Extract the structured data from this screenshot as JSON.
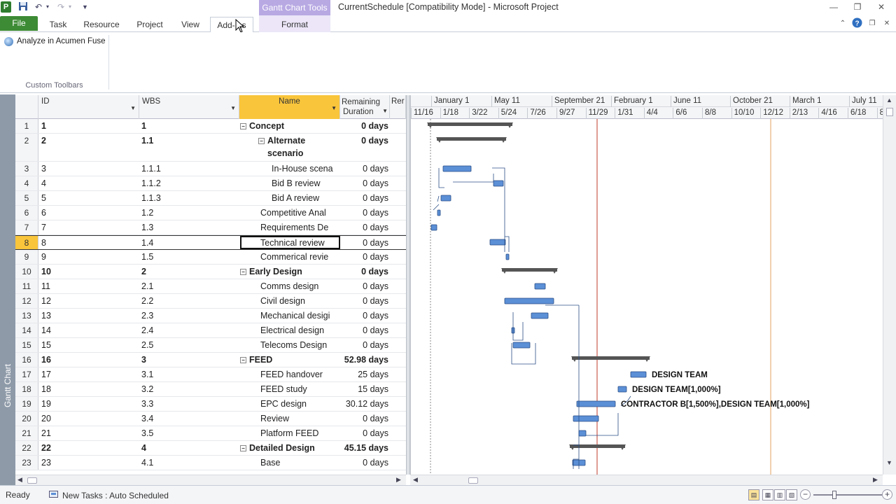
{
  "app": {
    "icon_letter": "P",
    "window_title": "CurrentSchedule [Compatibility Mode] - Microsoft Project",
    "contextual_group": "Gantt Chart Tools"
  },
  "ribbon": {
    "tabs": [
      "File",
      "Task",
      "Resource",
      "Project",
      "View",
      "Add-Ins",
      "Format"
    ],
    "active_tab": "Add-Ins",
    "add_ins": {
      "button_label": "Analyze in Acumen Fuse",
      "group_label": "Custom Toolbars"
    }
  },
  "view_bar": {
    "label": "Gantt Chart"
  },
  "table": {
    "headers": {
      "id": "ID",
      "wbs": "WBS",
      "name": "Name",
      "remaining_line1": "Remaining",
      "remaining_line2": "Duration",
      "truncated": "Rer"
    },
    "selected_row": 8,
    "rows": [
      {
        "row": "1",
        "id": "1",
        "wbs": "1",
        "name": "Concept",
        "remaining": "0 days",
        "summary": true,
        "level": 0
      },
      {
        "row": "2",
        "id": "2",
        "wbs": "1.1",
        "name": "Alternate scenario",
        "remaining": "0 days",
        "summary": true,
        "level": 1
      },
      {
        "row": "3",
        "id": "3",
        "wbs": "1.1.1",
        "name": "In-House scena",
        "remaining": "0 days",
        "summary": false,
        "level": 2
      },
      {
        "row": "4",
        "id": "4",
        "wbs": "1.1.2",
        "name": "Bid B review",
        "remaining": "0 days",
        "summary": false,
        "level": 2
      },
      {
        "row": "5",
        "id": "5",
        "wbs": "1.1.3",
        "name": "Bid A review",
        "remaining": "0 days",
        "summary": false,
        "level": 2
      },
      {
        "row": "6",
        "id": "6",
        "wbs": "1.2",
        "name": "Competitive Anal",
        "remaining": "0 days",
        "summary": false,
        "level": 1
      },
      {
        "row": "7",
        "id": "7",
        "wbs": "1.3",
        "name": "Requirements De",
        "remaining": "0 days",
        "summary": false,
        "level": 1
      },
      {
        "row": "8",
        "id": "8",
        "wbs": "1.4",
        "name": "Technical review",
        "remaining": "0 days",
        "summary": false,
        "level": 1
      },
      {
        "row": "9",
        "id": "9",
        "wbs": "1.5",
        "name": "Commerical revie",
        "remaining": "0 days",
        "summary": false,
        "level": 1
      },
      {
        "row": "10",
        "id": "10",
        "wbs": "2",
        "name": "Early Design",
        "remaining": "0 days",
        "summary": true,
        "level": 0
      },
      {
        "row": "11",
        "id": "11",
        "wbs": "2.1",
        "name": "Comms design",
        "remaining": "0 days",
        "summary": false,
        "level": 1
      },
      {
        "row": "12",
        "id": "12",
        "wbs": "2.2",
        "name": "Civil design",
        "remaining": "0 days",
        "summary": false,
        "level": 1
      },
      {
        "row": "13",
        "id": "13",
        "wbs": "2.3",
        "name": "Mechanical desigi",
        "remaining": "0 days",
        "summary": false,
        "level": 1
      },
      {
        "row": "14",
        "id": "14",
        "wbs": "2.4",
        "name": "Electrical design",
        "remaining": "0 days",
        "summary": false,
        "level": 1
      },
      {
        "row": "15",
        "id": "15",
        "wbs": "2.5",
        "name": "Telecoms Design",
        "remaining": "0 days",
        "summary": false,
        "level": 1
      },
      {
        "row": "16",
        "id": "16",
        "wbs": "3",
        "name": "FEED",
        "remaining": "52.98 days",
        "summary": true,
        "level": 0
      },
      {
        "row": "17",
        "id": "17",
        "wbs": "3.1",
        "name": "FEED handover",
        "remaining": "25 days",
        "summary": false,
        "level": 1
      },
      {
        "row": "18",
        "id": "18",
        "wbs": "3.2",
        "name": "FEED study",
        "remaining": "15 days",
        "summary": false,
        "level": 1
      },
      {
        "row": "19",
        "id": "19",
        "wbs": "3.3",
        "name": "EPC design",
        "remaining": "30.12 days",
        "summary": false,
        "level": 1
      },
      {
        "row": "20",
        "id": "20",
        "wbs": "3.4",
        "name": "Review",
        "remaining": "0 days",
        "summary": false,
        "level": 1
      },
      {
        "row": "21",
        "id": "21",
        "wbs": "3.5",
        "name": "Platform FEED",
        "remaining": "0 days",
        "summary": false,
        "level": 1
      },
      {
        "row": "22",
        "id": "22",
        "wbs": "4",
        "name": "Detailed Design",
        "remaining": "45.15 days",
        "summary": true,
        "level": 0
      },
      {
        "row": "23",
        "id": "23",
        "wbs": "4.1",
        "name": "Base",
        "remaining": "0 days",
        "summary": false,
        "level": 1
      }
    ]
  },
  "timescale": {
    "top": [
      "January 1",
      "May 11",
      "September 21",
      "February 1",
      "June 11",
      "October 21",
      "March 1",
      "July 11"
    ],
    "bottom": [
      "11/16",
      "1/18",
      "3/22",
      "5/24",
      "7/26",
      "9/27",
      "11/29",
      "1/31",
      "4/4",
      "6/6",
      "8/8",
      "10/10",
      "12/12",
      "2/13",
      "4/16",
      "6/18",
      "8/"
    ]
  },
  "gantt": {
    "resource_labels": {
      "row17": "DESIGN TEAM",
      "row18": "DESIGN TEAM[1,000%]",
      "row19": "CONTRACTOR B[1,500%],DESIGN TEAM[1,000%]"
    },
    "colors": {
      "task": "#5b8fd6",
      "summary": "#555555",
      "status_date": "#c0392b",
      "project_finish": "#e0a060"
    }
  },
  "status_bar": {
    "ready": "Ready",
    "new_tasks": "New Tasks : Auto Scheduled"
  }
}
